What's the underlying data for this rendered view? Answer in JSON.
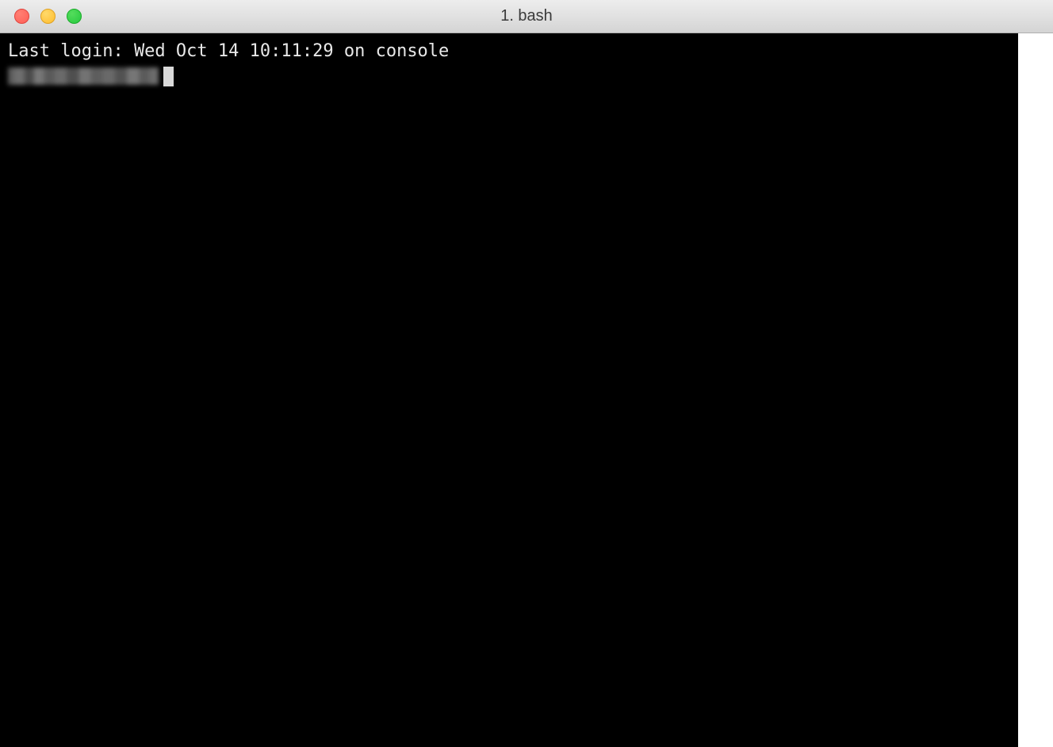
{
  "window": {
    "title": "1. bash"
  },
  "terminal": {
    "last_login_line": "Last login: Wed Oct 14 10:11:29 on console",
    "prompt_redacted": true
  },
  "colors": {
    "terminal_bg": "#000000",
    "terminal_fg": "#e8e8e8",
    "titlebar_top": "#ededed",
    "titlebar_bottom": "#d4d4d4",
    "close": "#ff5f56",
    "minimize": "#ffbd2e",
    "zoom": "#27c93f"
  }
}
